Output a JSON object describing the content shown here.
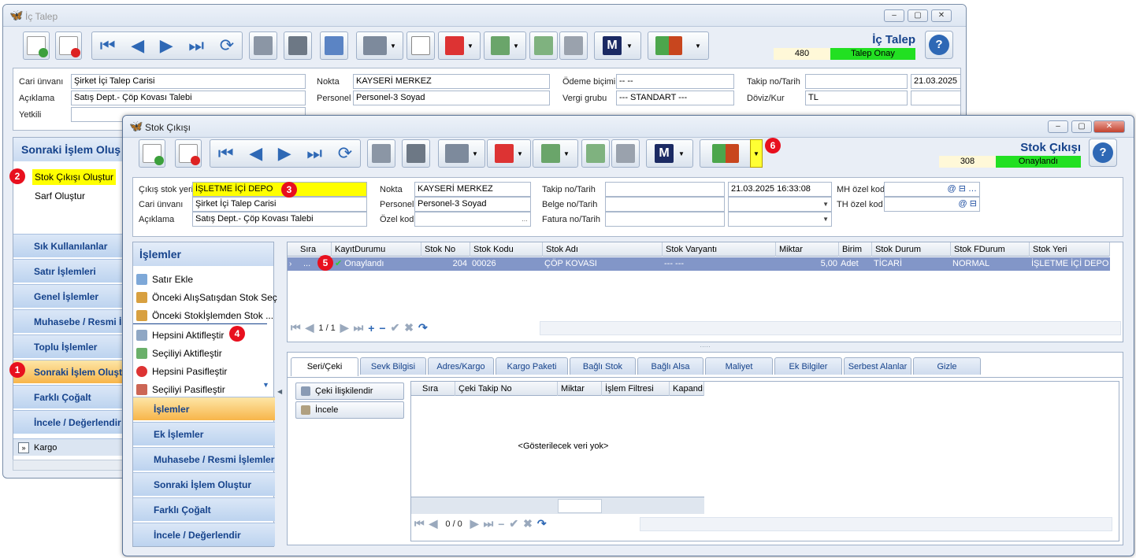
{
  "back_window": {
    "title": "İç Talep",
    "header_title": "İç Talep",
    "doc_no": "480",
    "status": "Talep Onay",
    "fields": {
      "cari_label": "Cari ünvanı",
      "cari_value": "Şirket İçi Talep Carisi",
      "aciklama_label": "Açıklama",
      "aciklama_value": "Satış Dept.- Çöp Kovası Talebi",
      "yetkili_label": "Yetkili",
      "nokta_label": "Nokta",
      "nokta_value": "KAYSERİ MERKEZ",
      "personel_label": "Personel",
      "personel_value": "Personel-3 Soyad",
      "odeme_label": "Ödeme biçimi",
      "odeme_value": "-- --",
      "vergi_label": "Vergi grubu",
      "vergi_value": "--- STANDART ---",
      "takip_label": "Takip no/Tarih",
      "takip_date": "21.03.2025",
      "doviz_label": "Döviz/Kur",
      "doviz_value": "TL"
    },
    "side_header": "Sonraki İşlem Oluş",
    "side_items": [
      "Stok Çıkışı Oluştur",
      "Sarf Oluştur"
    ],
    "nav": [
      "Sık Kullanılanlar",
      "Satır İşlemleri",
      "Genel İşlemler",
      "Muhasebe / Resmi İş",
      "Toplu İşlemler",
      "Sonraki İşlem Oluştu",
      "Farklı Çoğalt",
      "İncele / Değerlendir"
    ],
    "kargo": "Kargo"
  },
  "front_window": {
    "title": "Stok Çıkışı",
    "header_title": "Stok Çıkışı",
    "doc_no": "308",
    "status": "Onaylandı",
    "fields": {
      "cikis_label": "Çıkış stok yeri",
      "cikis_value": "İŞLETME İÇİ DEPO",
      "cari_label": "Cari ünvanı",
      "cari_value": "Şirket İçi Talep Carisi",
      "aciklama_label": "Açıklama",
      "aciklama_value": "Satış Dept.- Çöp Kovası Talebi",
      "nokta_label": "Nokta",
      "nokta_value": "KAYSERİ MERKEZ",
      "personel_label": "Personel",
      "personel_value": "Personel-3 Soyad",
      "ozel_label": "Özel kod",
      "takip_label": "Takip no/Tarih",
      "takip_date": "21.03.2025 16:33:08",
      "belge_label": "Belge no/Tarih",
      "fatura_label": "Fatura no/Tarih",
      "mh_label": "MH özel kod",
      "th_label": "TH özel kod"
    },
    "islemler_header": "İşlemler",
    "islemler_items": [
      "Satır Ekle",
      "Önceki AlışSatışdan Stok Seç",
      "Önceki Stokİşlemden Stok ...",
      "Hepsini Aktifleştir",
      "Seçiliyi Aktifleştir",
      "Hepsini Pasifleştir",
      "Seçiliyi Pasifleştir"
    ],
    "nav": [
      "İşlemler",
      "Ek İşlemler",
      "Muhasebe / Resmi İşlemler",
      "Sonraki İşlem Oluştur",
      "Farklı Çoğalt",
      "İncele / Değerlendir"
    ],
    "grid": {
      "columns": [
        "Sıra",
        "KayıtDurumu",
        "Stok No",
        "Stok Kodu",
        "Stok Adı",
        "Stok Varyantı",
        "Miktar",
        "Birim",
        "Stok Durum",
        "Stok FDurum",
        "Stok Yeri"
      ],
      "row": {
        "sira": "...",
        "durum": "Onaylandı",
        "stok_no": "204",
        "stok_kodu": "00026",
        "stok_adi": "ÇÖP KOVASI",
        "varyant": "--- ---",
        "miktar": "5,00",
        "birim": "Adet",
        "durum2": "TİCARİ",
        "fdurum": "NORMAL",
        "yer": "İŞLETME İÇİ DEPO"
      },
      "pager": "1 / 1"
    },
    "tabs": [
      "Seri/Çeki",
      "Sevk Bilgisi",
      "Adres/Kargo",
      "Kargo Paketi",
      "Bağlı Stok",
      "Bağlı Alsa",
      "Maliyet",
      "Ek Bilgiler",
      "Serbest Alanlar",
      "Gizle"
    ],
    "seri_buttons": [
      "Çeki İlişkilendir",
      "İncele"
    ],
    "seri_columns": [
      "Sıra",
      "Çeki Takip No",
      "Miktar",
      "İşlem Filtresi",
      "Kapandı"
    ],
    "empty_text": "<Gösterilecek veri yok>",
    "seri_pager": "0 / 0"
  },
  "markers": [
    "1",
    "2",
    "3",
    "4",
    "5",
    "6"
  ]
}
